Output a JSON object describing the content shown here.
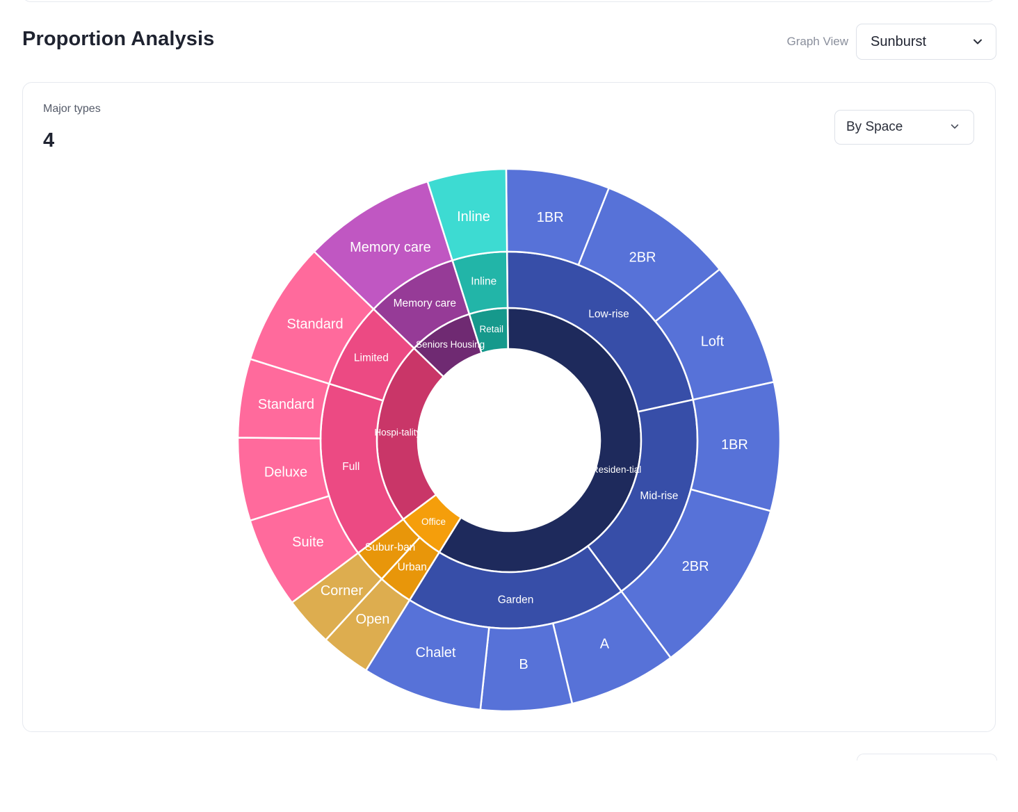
{
  "header": {
    "title": "Proportion Analysis",
    "view_label": "Graph View",
    "view_value": "Sunburst"
  },
  "card": {
    "metric_label": "Major types",
    "metric_value": "4",
    "grouping_value": "By Space"
  },
  "colors": {
    "accent_border": "#dde1e8",
    "text": "#1f2330",
    "muted": "#8a8f9c"
  },
  "icons": {
    "dropdown": "chevron-down-icon"
  },
  "chart_data": {
    "type": "sunburst",
    "note_values": "values are approximate angular shares estimated from the visual",
    "rings": [
      "major type",
      "subtype",
      "unit type"
    ],
    "nodes": [
      {
        "name": "Residen-tial",
        "color": "#1e2a5c",
        "children": [
          {
            "name": "Low-rise",
            "color": "#374ea8",
            "children": [
              {
                "name": "1BR",
                "value": 25,
                "color": "#5772d8"
              },
              {
                "name": "2BR",
                "value": 33,
                "color": "#5772d8"
              },
              {
                "name": "Loft",
                "value": 30,
                "color": "#5772d8"
              }
            ]
          },
          {
            "name": "Mid-rise",
            "color": "#374ea8",
            "children": [
              {
                "name": "1BR",
                "value": 31,
                "color": "#5772d8"
              },
              {
                "name": "2BR",
                "value": 43,
                "color": "#5772d8"
              }
            ]
          },
          {
            "name": "Garden",
            "color": "#374ea8",
            "children": [
              {
                "name": "A",
                "value": 26,
                "color": "#5772d8"
              },
              {
                "name": "B",
                "value": 22,
                "color": "#5772d8"
              },
              {
                "name": "Chalet",
                "value": 29,
                "color": "#5772d8"
              }
            ]
          }
        ]
      },
      {
        "name": "Office",
        "color": "#f59e0b",
        "children": [
          {
            "name": "Urban",
            "color": "#e8960a",
            "children": [
              {
                "name": "Open",
                "value": 12,
                "color": "#ddad4f"
              }
            ]
          },
          {
            "name": "Subur-ban",
            "color": "#e8960a",
            "children": [
              {
                "name": "Corner",
                "value": 12,
                "color": "#ddad4f"
              }
            ]
          }
        ]
      },
      {
        "name": "Hospi-tality",
        "color": "#c93668",
        "children": [
          {
            "name": "Full",
            "color": "#ec4a83",
            "children": [
              {
                "name": "Suite",
                "value": 22,
                "color": "#ff6a9c"
              },
              {
                "name": "Deluxe",
                "value": 20,
                "color": "#ff6a9c"
              },
              {
                "name": "Standard",
                "value": 19,
                "color": "#ff6a9c"
              }
            ]
          },
          {
            "name": "Limited",
            "color": "#ec4a83",
            "children": [
              {
                "name": "Standard",
                "value": 30,
                "color": "#ff6a9c"
              }
            ]
          }
        ]
      },
      {
        "name": "Seniors Housing",
        "color": "#6f2a72",
        "children": [
          {
            "name": "Memory care",
            "color": "#963b97",
            "children": [
              {
                "name": "Memory care",
                "value": 32,
                "color": "#c057c2"
              }
            ]
          }
        ]
      },
      {
        "name": "Retail",
        "color": "#16998c",
        "children": [
          {
            "name": "Inline",
            "color": "#22b5a8",
            "children": [
              {
                "name": "Inline",
                "value": 19,
                "color": "#3ddbd2"
              }
            ]
          }
        ]
      }
    ]
  }
}
